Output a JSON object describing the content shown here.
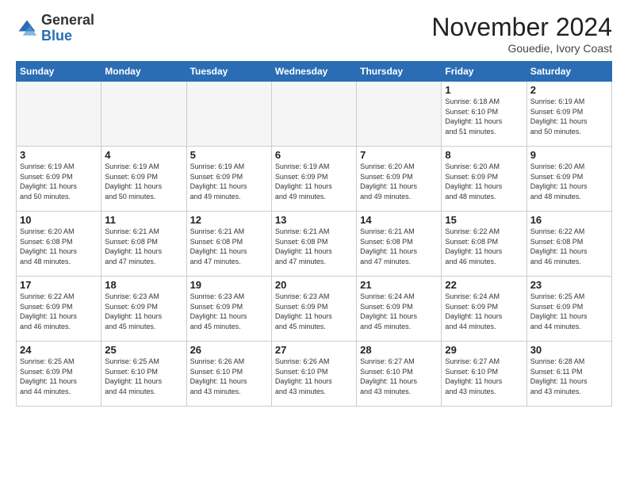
{
  "header": {
    "logo_general": "General",
    "logo_blue": "Blue",
    "month_title": "November 2024",
    "subtitle": "Gouedie, Ivory Coast"
  },
  "weekdays": [
    "Sunday",
    "Monday",
    "Tuesday",
    "Wednesday",
    "Thursday",
    "Friday",
    "Saturday"
  ],
  "weeks": [
    [
      {
        "day": "",
        "info": "",
        "empty": true
      },
      {
        "day": "",
        "info": "",
        "empty": true
      },
      {
        "day": "",
        "info": "",
        "empty": true
      },
      {
        "day": "",
        "info": "",
        "empty": true
      },
      {
        "day": "",
        "info": "",
        "empty": true
      },
      {
        "day": "1",
        "info": "Sunrise: 6:18 AM\nSunset: 6:10 PM\nDaylight: 11 hours\nand 51 minutes."
      },
      {
        "day": "2",
        "info": "Sunrise: 6:19 AM\nSunset: 6:09 PM\nDaylight: 11 hours\nand 50 minutes."
      }
    ],
    [
      {
        "day": "3",
        "info": "Sunrise: 6:19 AM\nSunset: 6:09 PM\nDaylight: 11 hours\nand 50 minutes."
      },
      {
        "day": "4",
        "info": "Sunrise: 6:19 AM\nSunset: 6:09 PM\nDaylight: 11 hours\nand 50 minutes."
      },
      {
        "day": "5",
        "info": "Sunrise: 6:19 AM\nSunset: 6:09 PM\nDaylight: 11 hours\nand 49 minutes."
      },
      {
        "day": "6",
        "info": "Sunrise: 6:19 AM\nSunset: 6:09 PM\nDaylight: 11 hours\nand 49 minutes."
      },
      {
        "day": "7",
        "info": "Sunrise: 6:20 AM\nSunset: 6:09 PM\nDaylight: 11 hours\nand 49 minutes."
      },
      {
        "day": "8",
        "info": "Sunrise: 6:20 AM\nSunset: 6:09 PM\nDaylight: 11 hours\nand 48 minutes."
      },
      {
        "day": "9",
        "info": "Sunrise: 6:20 AM\nSunset: 6:09 PM\nDaylight: 11 hours\nand 48 minutes."
      }
    ],
    [
      {
        "day": "10",
        "info": "Sunrise: 6:20 AM\nSunset: 6:08 PM\nDaylight: 11 hours\nand 48 minutes."
      },
      {
        "day": "11",
        "info": "Sunrise: 6:21 AM\nSunset: 6:08 PM\nDaylight: 11 hours\nand 47 minutes."
      },
      {
        "day": "12",
        "info": "Sunrise: 6:21 AM\nSunset: 6:08 PM\nDaylight: 11 hours\nand 47 minutes."
      },
      {
        "day": "13",
        "info": "Sunrise: 6:21 AM\nSunset: 6:08 PM\nDaylight: 11 hours\nand 47 minutes."
      },
      {
        "day": "14",
        "info": "Sunrise: 6:21 AM\nSunset: 6:08 PM\nDaylight: 11 hours\nand 47 minutes."
      },
      {
        "day": "15",
        "info": "Sunrise: 6:22 AM\nSunset: 6:08 PM\nDaylight: 11 hours\nand 46 minutes."
      },
      {
        "day": "16",
        "info": "Sunrise: 6:22 AM\nSunset: 6:08 PM\nDaylight: 11 hours\nand 46 minutes."
      }
    ],
    [
      {
        "day": "17",
        "info": "Sunrise: 6:22 AM\nSunset: 6:09 PM\nDaylight: 11 hours\nand 46 minutes."
      },
      {
        "day": "18",
        "info": "Sunrise: 6:23 AM\nSunset: 6:09 PM\nDaylight: 11 hours\nand 45 minutes."
      },
      {
        "day": "19",
        "info": "Sunrise: 6:23 AM\nSunset: 6:09 PM\nDaylight: 11 hours\nand 45 minutes."
      },
      {
        "day": "20",
        "info": "Sunrise: 6:23 AM\nSunset: 6:09 PM\nDaylight: 11 hours\nand 45 minutes."
      },
      {
        "day": "21",
        "info": "Sunrise: 6:24 AM\nSunset: 6:09 PM\nDaylight: 11 hours\nand 45 minutes."
      },
      {
        "day": "22",
        "info": "Sunrise: 6:24 AM\nSunset: 6:09 PM\nDaylight: 11 hours\nand 44 minutes."
      },
      {
        "day": "23",
        "info": "Sunrise: 6:25 AM\nSunset: 6:09 PM\nDaylight: 11 hours\nand 44 minutes."
      }
    ],
    [
      {
        "day": "24",
        "info": "Sunrise: 6:25 AM\nSunset: 6:09 PM\nDaylight: 11 hours\nand 44 minutes."
      },
      {
        "day": "25",
        "info": "Sunrise: 6:25 AM\nSunset: 6:10 PM\nDaylight: 11 hours\nand 44 minutes."
      },
      {
        "day": "26",
        "info": "Sunrise: 6:26 AM\nSunset: 6:10 PM\nDaylight: 11 hours\nand 43 minutes."
      },
      {
        "day": "27",
        "info": "Sunrise: 6:26 AM\nSunset: 6:10 PM\nDaylight: 11 hours\nand 43 minutes."
      },
      {
        "day": "28",
        "info": "Sunrise: 6:27 AM\nSunset: 6:10 PM\nDaylight: 11 hours\nand 43 minutes."
      },
      {
        "day": "29",
        "info": "Sunrise: 6:27 AM\nSunset: 6:10 PM\nDaylight: 11 hours\nand 43 minutes."
      },
      {
        "day": "30",
        "info": "Sunrise: 6:28 AM\nSunset: 6:11 PM\nDaylight: 11 hours\nand 43 minutes."
      }
    ]
  ]
}
